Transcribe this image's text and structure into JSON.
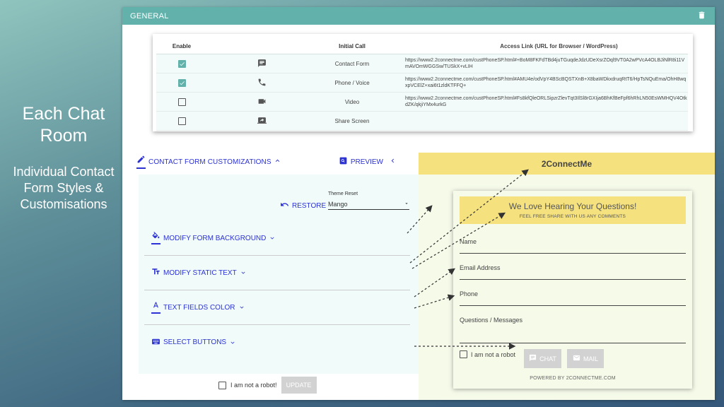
{
  "slide": {
    "heading": "Each Chat Room",
    "subtitle": "Individual Contact Form Styles & Customisations"
  },
  "topbar": {
    "title": "GENERAL",
    "delete_icon": "trash-icon"
  },
  "table": {
    "headers": {
      "enable": "Enable",
      "initial_call": "Initial Call",
      "access_link": "Access Link (URL for Browser / WordPress)"
    },
    "rows": [
      {
        "enabled": true,
        "icon": "chat-icon",
        "call": "Contact Form",
        "link": "https://www2.2connectme.com/custPhoneSP.html#+BoM8FKFdTBd4juTGuqdeJdzUDeXsrZOql9VT0A2wPVcA4OLBJiNlR8i11VmAVOmWGGSw/TUSkX+vLIH"
      },
      {
        "enabled": true,
        "icon": "phone-icon",
        "call": "Phone / Voice",
        "link": "https://www2.2connectme.com/custPhoneSP.html#AMU4e/odVpY4BScBQSTXnB+X8baWDkxdruqRtT6/HpTsNQuEma/OhH8wqxpVCElZ+xai6t1zldKTFFQ+"
      },
      {
        "enabled": false,
        "icon": "video-icon",
        "call": "Video",
        "link": "https://www2.2connectme.com/custPhoneSP.html#Fs8kfQleORLSipzrZlevTqt3IlSl8rGXIja6BhKfBeFpf6hRhLN50EsWMHQV4OtkdZK/qkjiYMx4urkG"
      },
      {
        "enabled": false,
        "icon": "screen-share-icon",
        "call": "Share Screen",
        "link": ""
      }
    ]
  },
  "customization": {
    "title": "CONTACT FORM CUSTOMIZATIONS",
    "preview_label": "PREVIEW",
    "restore_label": "RESTORE",
    "theme_label": "Theme Reset",
    "theme_value": "Mango",
    "sections": [
      {
        "label": "MODIFY FORM BACKGROUND",
        "icon": "paint-bucket-icon"
      },
      {
        "label": "MODIFY STATIC TEXT",
        "icon": "text-format-icon"
      },
      {
        "label": "TEXT FIELDS COLOR",
        "icon": "text-color-icon"
      },
      {
        "label": "SELECT BUTTONS",
        "icon": "keyboard-icon"
      }
    ],
    "robot_label": "I am not a robot!",
    "update_label": "UPDATE"
  },
  "preview": {
    "brand": "2ConnectMe",
    "form_title": "We Love Hearing Your Questions!",
    "form_subtitle": "FEEL FREE SHARE WITH US ANY COMMENTS",
    "fields": [
      "Name",
      "Email Address",
      "Phone",
      "Questions / Messages"
    ],
    "robot_label": "I am not a robot",
    "chat_label": "CHAT",
    "mail_label": "MAIL",
    "powered_by": "POWERED BY 2CONNECTME.COM"
  },
  "colors": {
    "teal": "#63b1ab",
    "accent_blue": "#2c32d4",
    "mango": "#f5e17e",
    "preview_bg": "#f5fae9",
    "disabled_button": "#d2d2d2"
  }
}
